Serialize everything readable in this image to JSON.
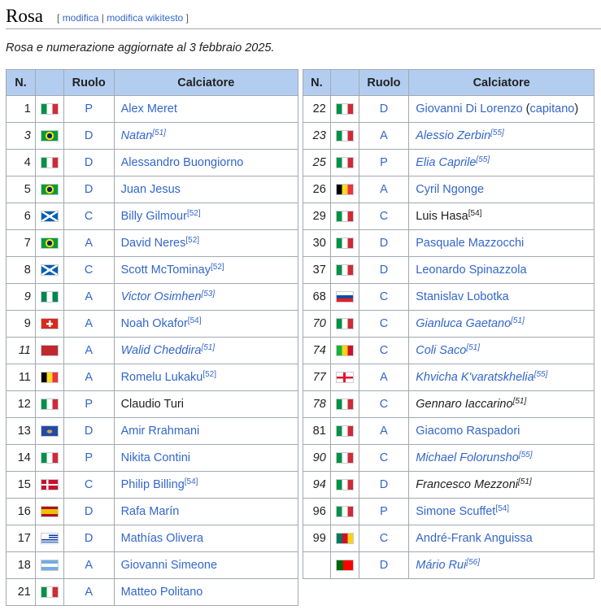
{
  "heading": {
    "title": "Rosa",
    "edit_open": "[",
    "edit_link1": "modifica",
    "edit_sep": "|",
    "edit_link2": "modifica wikitesto",
    "edit_close": "]"
  },
  "note": "Rosa e numerazione aggiornate al 3 febbraio 2025.",
  "columns": {
    "num": "N.",
    "role": "Ruolo",
    "player": "Calciatore"
  },
  "flag_styles": {
    "ita": "linear-gradient(to right,#009246 0 33.3%,#fff 33.3% 66.6%,#ce2b37 66.6%)",
    "bra": "radial-gradient(circle at 50% 50%,#002776 0 3px,#fedf00 3.2px 5px,#009c3b 5.2px)",
    "sco": "linear-gradient(32deg,transparent 44%,#fff 44% 56%,transparent 56%),linear-gradient(-32deg,transparent 44%,#fff 44% 56%,transparent 56%),#005eb8",
    "nga": "linear-gradient(to right,#008751 0 33.3%,#fff 33.3% 66.6%,#008751 66.6%)",
    "sui": "linear-gradient(#fff,#fff) center/8px 2.5px no-repeat,linear-gradient(#fff,#fff) center/2.5px 8px no-repeat,#da291c",
    "mar": "#c1272d",
    "bel": "linear-gradient(to right,#000 0 33.3%,#fdda24 33.3% 66.6%,#ef3340 66.6%)",
    "kos": "radial-gradient(ellipse at 50% 55%,#d0a650 0 3px,#244aa5 3.5px)",
    "den": "linear-gradient(to right,transparent 0 30%,#fff 30% 43%,transparent 43%),linear-gradient(transparent 0 40%,#fff 40% 60%,transparent 60%),#c8102e",
    "esp": "linear-gradient(#aa151b 0 25%,#f1bf00 25% 75%,#aa151b 75%)",
    "uru": "linear-gradient(to right,#fff 0 45%,transparent 45%) top/100% 50% no-repeat,repeating-linear-gradient(#fff 0 1.4px,#0038a8 1.4px 2.8px)",
    "arg": "linear-gradient(#74acdf 0 33.3%,#fff 33.3% 66.6%,#74acdf 66.6%)",
    "geo": "linear-gradient(#e8112d,#e8112d) center/100% 2.5px no-repeat,linear-gradient(#e8112d,#e8112d) center/3px 100% no-repeat,#fff",
    "svk": "linear-gradient(#fff 0 33.3%,#0b4ea2 33.3% 66.6%,#ee1c25 66.6%)",
    "cmr": "linear-gradient(to right,#007a5e 0 33.3%,#ce1126 33.3% 66.6%,#fcd116 66.6%)",
    "mli": "linear-gradient(to right,#14b53a 0 33.3%,#fcd116 33.3% 66.6%,#ce1126 66.6%)",
    "por": "linear-gradient(to right,#006600 0 40%,#ff0000 40%)"
  },
  "players_left": [
    {
      "num": "1",
      "num_italic": false,
      "flag": "ita",
      "role": "P",
      "name": "Alex Meret",
      "name_italic": false,
      "linked": true,
      "ref": ""
    },
    {
      "num": "3",
      "num_italic": true,
      "flag": "bra",
      "role": "D",
      "name": "Natan",
      "name_italic": true,
      "linked": true,
      "ref": "[51]"
    },
    {
      "num": "4",
      "num_italic": false,
      "flag": "ita",
      "role": "D",
      "name": "Alessandro Buongiorno",
      "name_italic": false,
      "linked": true,
      "ref": ""
    },
    {
      "num": "5",
      "num_italic": false,
      "flag": "bra",
      "role": "D",
      "name": "Juan Jesus",
      "name_italic": false,
      "linked": true,
      "ref": ""
    },
    {
      "num": "6",
      "num_italic": false,
      "flag": "sco",
      "role": "C",
      "name": "Billy Gilmour",
      "name_italic": false,
      "linked": true,
      "ref": "[52]"
    },
    {
      "num": "7",
      "num_italic": false,
      "flag": "bra",
      "role": "A",
      "name": "David Neres",
      "name_italic": false,
      "linked": true,
      "ref": "[52]"
    },
    {
      "num": "8",
      "num_italic": false,
      "flag": "sco",
      "role": "C",
      "name": "Scott McTominay",
      "name_italic": false,
      "linked": true,
      "ref": "[52]"
    },
    {
      "num": "9",
      "num_italic": true,
      "flag": "nga",
      "role": "A",
      "name": "Victor Osimhen",
      "name_italic": true,
      "linked": true,
      "ref": "[53]"
    },
    {
      "num": "9",
      "num_italic": false,
      "flag": "sui",
      "role": "A",
      "name": "Noah Okafor",
      "name_italic": false,
      "linked": true,
      "ref": "[54]"
    },
    {
      "num": "11",
      "num_italic": true,
      "flag": "mar",
      "role": "A",
      "name": "Walid Cheddira",
      "name_italic": true,
      "linked": true,
      "ref": "[51]"
    },
    {
      "num": "11",
      "num_italic": false,
      "flag": "bel",
      "role": "A",
      "name": "Romelu Lukaku",
      "name_italic": false,
      "linked": true,
      "ref": "[52]"
    },
    {
      "num": "12",
      "num_italic": false,
      "flag": "ita",
      "role": "P",
      "name": "Claudio Turi",
      "name_italic": false,
      "linked": false,
      "ref": ""
    },
    {
      "num": "13",
      "num_italic": false,
      "flag": "kos",
      "role": "D",
      "name": "Amir Rrahmani",
      "name_italic": false,
      "linked": true,
      "ref": ""
    },
    {
      "num": "14",
      "num_italic": false,
      "flag": "ita",
      "role": "P",
      "name": "Nikita Contini",
      "name_italic": false,
      "linked": true,
      "ref": ""
    },
    {
      "num": "15",
      "num_italic": false,
      "flag": "den",
      "role": "C",
      "name": "Philip Billing",
      "name_italic": false,
      "linked": true,
      "ref": "[54]"
    },
    {
      "num": "16",
      "num_italic": false,
      "flag": "esp",
      "role": "D",
      "name": "Rafa Marín",
      "name_italic": false,
      "linked": true,
      "ref": ""
    },
    {
      "num": "17",
      "num_italic": false,
      "flag": "uru",
      "role": "D",
      "name": "Mathías Olivera",
      "name_italic": false,
      "linked": true,
      "ref": ""
    },
    {
      "num": "18",
      "num_italic": false,
      "flag": "arg",
      "role": "A",
      "name": "Giovanni Simeone",
      "name_italic": false,
      "linked": true,
      "ref": ""
    },
    {
      "num": "21",
      "num_italic": false,
      "flag": "ita",
      "role": "A",
      "name": "Matteo Politano",
      "name_italic": false,
      "linked": true,
      "ref": ""
    }
  ],
  "players_right": [
    {
      "num": "22",
      "num_italic": false,
      "flag": "ita",
      "role": "D",
      "name": "Giovanni Di Lorenzo",
      "name_italic": false,
      "linked": true,
      "ref": "",
      "captain": "capitano"
    },
    {
      "num": "23",
      "num_italic": true,
      "flag": "ita",
      "role": "A",
      "name": "Alessio Zerbin",
      "name_italic": true,
      "linked": true,
      "ref": "[55]"
    },
    {
      "num": "25",
      "num_italic": true,
      "flag": "ita",
      "role": "P",
      "name": "Elia Caprile",
      "name_italic": true,
      "linked": true,
      "ref": "[55]"
    },
    {
      "num": "26",
      "num_italic": false,
      "flag": "bel",
      "role": "A",
      "name": "Cyril Ngonge",
      "name_italic": false,
      "linked": true,
      "ref": ""
    },
    {
      "num": "29",
      "num_italic": false,
      "flag": "ita",
      "role": "C",
      "name": "Luis Hasa",
      "name_italic": false,
      "linked": false,
      "ref": "[54]"
    },
    {
      "num": "30",
      "num_italic": false,
      "flag": "ita",
      "role": "D",
      "name": "Pasquale Mazzocchi",
      "name_italic": false,
      "linked": true,
      "ref": ""
    },
    {
      "num": "37",
      "num_italic": false,
      "flag": "ita",
      "role": "D",
      "name": "Leonardo Spinazzola",
      "name_italic": false,
      "linked": true,
      "ref": ""
    },
    {
      "num": "68",
      "num_italic": false,
      "flag": "svk",
      "role": "C",
      "name": "Stanislav Lobotka",
      "name_italic": false,
      "linked": true,
      "ref": ""
    },
    {
      "num": "70",
      "num_italic": true,
      "flag": "ita",
      "role": "C",
      "name": "Gianluca Gaetano",
      "name_italic": true,
      "linked": true,
      "ref": "[51]"
    },
    {
      "num": "74",
      "num_italic": true,
      "flag": "mli",
      "role": "C",
      "name": "Coli Saco",
      "name_italic": true,
      "linked": true,
      "ref": "[51]"
    },
    {
      "num": "77",
      "num_italic": true,
      "flag": "geo",
      "role": "A",
      "name": "Khvicha K'varatskhelia",
      "name_italic": true,
      "linked": true,
      "ref": "[55]"
    },
    {
      "num": "78",
      "num_italic": true,
      "flag": "ita",
      "role": "C",
      "name": "Gennaro Iaccarino",
      "name_italic": true,
      "linked": false,
      "ref": "[51]"
    },
    {
      "num": "81",
      "num_italic": false,
      "flag": "ita",
      "role": "A",
      "name": "Giacomo Raspadori",
      "name_italic": false,
      "linked": true,
      "ref": ""
    },
    {
      "num": "90",
      "num_italic": true,
      "flag": "ita",
      "role": "C",
      "name": "Michael Folorunsho",
      "name_italic": true,
      "linked": true,
      "ref": "[55]"
    },
    {
      "num": "94",
      "num_italic": true,
      "flag": "ita",
      "role": "D",
      "name": "Francesco Mezzoni",
      "name_italic": true,
      "linked": false,
      "ref": "[51]"
    },
    {
      "num": "96",
      "num_italic": false,
      "flag": "ita",
      "role": "P",
      "name": "Simone Scuffet",
      "name_italic": false,
      "linked": true,
      "ref": "[54]"
    },
    {
      "num": "99",
      "num_italic": false,
      "flag": "cmr",
      "role": "C",
      "name": "André-Frank Anguissa",
      "name_italic": false,
      "linked": true,
      "ref": ""
    },
    {
      "num": "",
      "num_italic": false,
      "flag": "por",
      "role": "D",
      "name": "Mário Rui",
      "name_italic": true,
      "linked": true,
      "ref": "[56]"
    }
  ]
}
